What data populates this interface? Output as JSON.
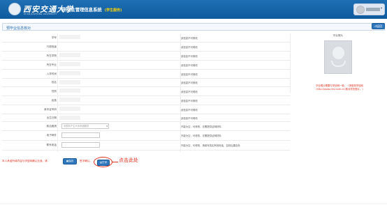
{
  "header": {
    "logo_cn": "西安交通大学",
    "logo_en": "XI'AN JIAOTONG UNIVERSITY",
    "system_title": "研究生管理信息系统",
    "system_subtitle": "(学生服务)"
  },
  "page": {
    "title": "预毕业信息核对",
    "back_label": "返回"
  },
  "form": {
    "rows": [
      {
        "label": "学号",
        "note": "该信息不可修改"
      },
      {
        "label": "行政班级",
        "note": "该信息不可修改"
      },
      {
        "label": "所在学院",
        "note": "该信息不可修改"
      },
      {
        "label": "所在专业",
        "note": "该信息不可修改"
      },
      {
        "label": "入学时间",
        "note": "该信息不可修改"
      },
      {
        "label": "姓名",
        "note": "该信息不可修改"
      },
      {
        "label": "性别",
        "note": "该信息不可修改"
      },
      {
        "label": "民族",
        "note": "该信息不可修改"
      },
      {
        "label": "身份证号码",
        "note": "该信息不可修改"
      },
      {
        "label": "出生日期",
        "note": "该信息不可修改"
      },
      {
        "label": "政治面貌",
        "note": "不能为空，可修改，无需提供证明材料"
      },
      {
        "label": "电子邮件",
        "note": "不能为空，可修改，无需提供证明材料"
      },
      {
        "label": "联系电话",
        "note": "不能为空，可修改，请填写真实有效电话，否则后果自负"
      }
    ],
    "political_select": "中国共产主义青年团团员",
    "email_value": "",
    "phone_value": ""
  },
  "photo": {
    "label": "毕业照片",
    "note_line1": "毕业照片需要与学信网一致，（请登录学信网",
    "note_line2": "(http://www.chsi.com.cn)核对学历照片。)"
  },
  "bottom": {
    "confirm_text": "本人承诺所填内容与学信网确认无误，请",
    "confirm_text2": "签字确认。",
    "save_label": "保存",
    "print_label": "打印",
    "hint": "点击此处"
  },
  "colors": {
    "header": "#1f6fb4",
    "accent": "#2f77bd",
    "warning": "#e0301e"
  }
}
